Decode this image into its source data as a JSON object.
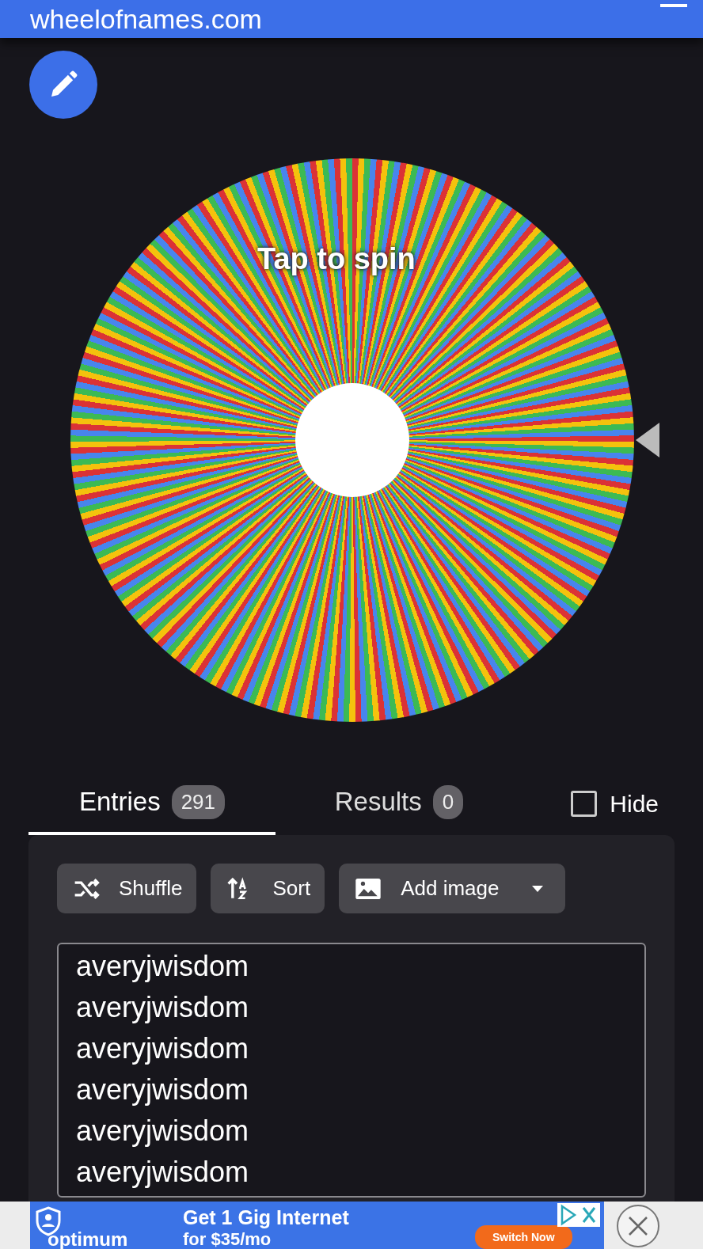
{
  "header": {
    "title": "wheelofnames.com"
  },
  "wheel": {
    "label": "Tap to spin"
  },
  "tabs": [
    {
      "label": "Entries",
      "count": "291",
      "selected": true
    },
    {
      "label": "Results",
      "count": "0",
      "selected": false
    }
  ],
  "hide": {
    "label": "Hide",
    "checked": false
  },
  "toolbar": [
    {
      "kind": "shuffle",
      "label": "Shuffle"
    },
    {
      "kind": "sort",
      "label": "Sort"
    },
    {
      "kind": "image",
      "label": "Add image"
    }
  ],
  "entries": [
    "averyjwisdom",
    "averyjwisdom",
    "averyjwisdom",
    "averyjwisdom",
    "averyjwisdom",
    "averyjwisdom"
  ],
  "ad": {
    "headline": "Get 1 Gig Internet",
    "subline": "for $35/mo",
    "brand": "optimum",
    "button": "Switch Now"
  }
}
